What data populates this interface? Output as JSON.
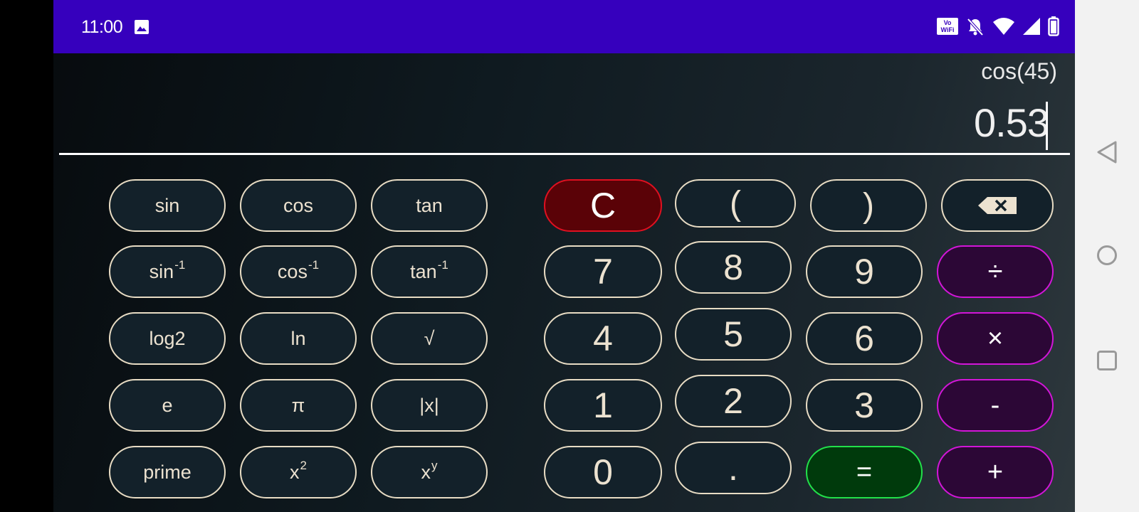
{
  "status_bar": {
    "time": "11:00",
    "icons": [
      "image-icon",
      "vowifi-icon",
      "bell-off-icon",
      "wifi-icon",
      "signal-icon",
      "battery-icon"
    ],
    "vowifi_label_top": "Vo",
    "vowifi_label_bottom": "WiFi",
    "background_color": "#3600bd"
  },
  "display": {
    "expression": "cos(45)",
    "result": "0.53"
  },
  "scientific_keys": {
    "sin": "sin",
    "cos": "cos",
    "tan": "tan",
    "asin": "sin",
    "acos": "cos",
    "atan": "tan",
    "inverse_sup": "-1",
    "log2": "log2",
    "ln": "ln",
    "sqrt": "√",
    "e": "e",
    "pi": "π",
    "abs": "|x|",
    "prime": "prime",
    "square_base": "x",
    "square_sup": "2",
    "power_base": "x",
    "power_sup": "y"
  },
  "keypad": {
    "clear": "C",
    "open_paren": "(",
    "close_paren": ")",
    "backspace_icon": "backspace-icon",
    "seven": "7",
    "eight": "8",
    "nine": "9",
    "divide": "÷",
    "four": "4",
    "five": "5",
    "six": "6",
    "multiply": "×",
    "one": "1",
    "two": "2",
    "three": "3",
    "subtract": "-",
    "zero": "0",
    "decimal": ".",
    "equals": "=",
    "add": "+"
  },
  "colors": {
    "key_border": "#e8dcc4",
    "clear_key": "#5a0207",
    "operator_key_border": "#d216d8",
    "equals_key_border": "#22e04a"
  },
  "nav_bar": {
    "icons": [
      "back-icon",
      "home-icon",
      "recents-icon"
    ]
  }
}
